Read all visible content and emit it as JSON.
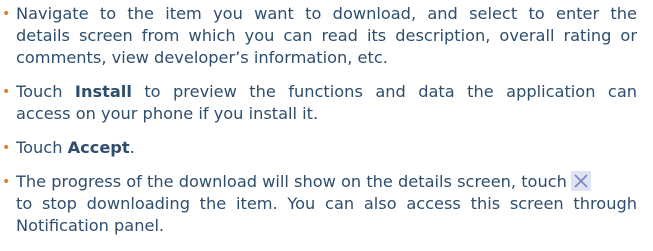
{
  "bullet_char": "•",
  "items": [
    {
      "lines": [
        "Navigate to the item you want to download, and select to enter the",
        "details screen from which you can read its description, overall rating or",
        "comments, view developer’s information, etc."
      ]
    },
    {
      "line1_pre": "Touch ",
      "line1_bold": "Install",
      "line1_post": " to preview the functions and data the application can",
      "line2": "access on your phone if you install it."
    },
    {
      "pre": "Touch ",
      "bold": "Accept",
      "post": "."
    },
    {
      "line1": "The progress of the download will show on the details screen, touch",
      "line2": "to stop downloading the item. You can also access this screen through",
      "line3": "Notification panel.",
      "icon": "close-x-icon"
    }
  ],
  "colors": {
    "text": "#2e4e6e",
    "bullet": "#e07a30",
    "icon_bg": "#dfe4f4",
    "icon_stroke": "#7a7fc6"
  }
}
